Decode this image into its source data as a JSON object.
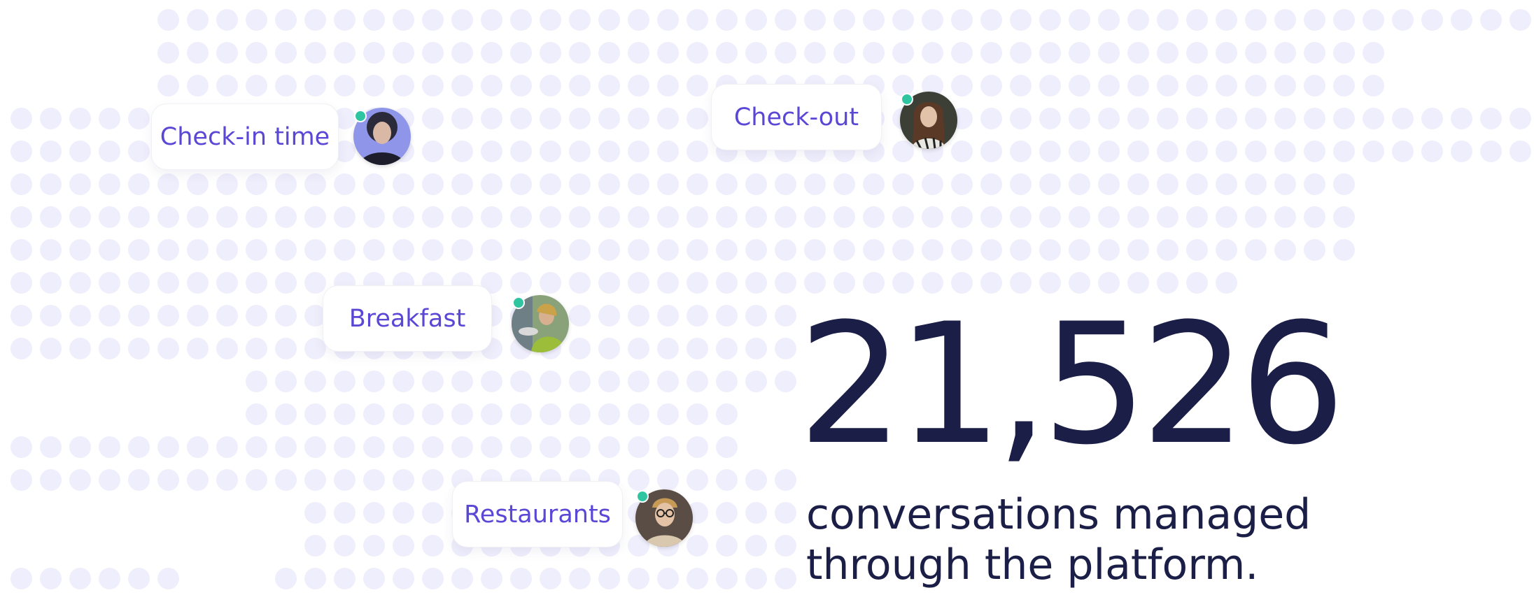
{
  "colors": {
    "dot": "#efeefc",
    "chip_text": "#5a47d6",
    "online": "#2ec5a0",
    "stat_text": "#1b1e46"
  },
  "topics": [
    {
      "label": "Check-in time",
      "avatar": "avatar-woman-dark-hair-icon"
    },
    {
      "label": "Check-out",
      "avatar": "avatar-woman-long-hair-icon"
    },
    {
      "label": "Breakfast",
      "avatar": "avatar-woman-kitchen-icon"
    },
    {
      "label": "Restaurants",
      "avatar": "avatar-man-glasses-icon"
    }
  ],
  "stat": {
    "number": "21,526",
    "caption_line1": "conversations managed",
    "caption_line2": "through the platform."
  }
}
